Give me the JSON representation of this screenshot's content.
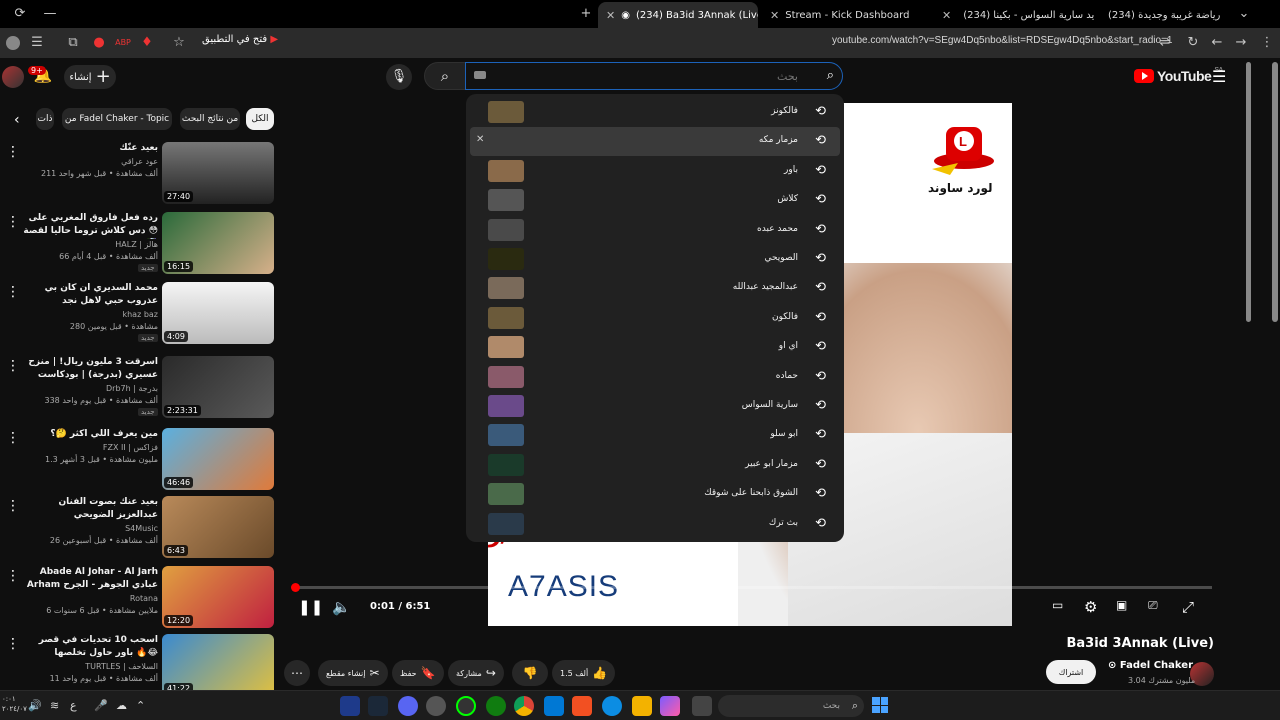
{
  "browser": {
    "tabs": [
      {
        "label": "(234) جربنا رياضة غريبة وجديدة"
      },
      {
        "label": "(234) جديد سارية السواس - بكينا"
      },
      {
        "label": "Stream - Kick Dashboard"
      },
      {
        "label": "(234) Ba3id 3Annak (Live)"
      }
    ],
    "open_in_app_label": "فتح في التطبيق",
    "url": "youtube.com/watch?v=SEgw4Dq5nbo&list=RDSEgw4Dq5nbo&start_radio=1"
  },
  "youtube": {
    "logo_text": "YouTube",
    "region": "SA",
    "create_label": "إنشاء",
    "notification_count": "9+",
    "search": {
      "placeholder": "بحث",
      "value": ""
    }
  },
  "suggestions": [
    {
      "label": "فالكونز"
    },
    {
      "label": "مزمار مكه"
    },
    {
      "label": "باور"
    },
    {
      "label": "كلاش"
    },
    {
      "label": "محمد عبده"
    },
    {
      "label": "الصويحي"
    },
    {
      "label": "عبدالمجيد عبدالله"
    },
    {
      "label": "فالكون"
    },
    {
      "label": "اي او"
    },
    {
      "label": "حماده"
    },
    {
      "label": "سارية السواس"
    },
    {
      "label": "ابو سلو"
    },
    {
      "label": "مزمار ابو عبير"
    },
    {
      "label": "الشوق ذابحنا على شوقك"
    },
    {
      "label": "بث ترك"
    }
  ],
  "chips": [
    {
      "label": "الكل"
    },
    {
      "label": "من نتائج البحث"
    },
    {
      "label": "من Fadel Chaker - Topic"
    },
    {
      "label": "ذات"
    }
  ],
  "related": [
    {
      "title": "بعيد عنّك",
      "channel": "عود عراقي",
      "meta": "211 ألف مشاهدة • قبل شهر واحد",
      "duration": "27:40",
      "new": ""
    },
    {
      "title": "رده فعل فاروق المغربي على دس كلاش تروما حاليا لقصة 😳🤯",
      "channel": "HALZ | هالز",
      "meta": "66 ألف مشاهدة • قبل 4 أيام",
      "duration": "16:15",
      "new": "جديد"
    },
    {
      "title": "محمد السديري ان كان بي عذروب حبي لاهل نجد",
      "channel": "khaz baz",
      "meta": "280 مشاهدة • قبل يومين",
      "duration": "4:09",
      "new": "جديد"
    },
    {
      "title": "اسرقت 3 مليون ريال! | منزح عسيري (بدرجة) | بودكاست يسير خير",
      "channel": "Drb7h | بدرجة",
      "meta": "338 ألف مشاهدة • قبل يوم واحد",
      "duration": "2:23:31",
      "new": "جديد"
    },
    {
      "title": "مين يعرف اللي اكثر 🤔؟",
      "channel": "FZX II | فزاكس",
      "meta": "1.3 مليون مشاهدة • قبل 3 أشهر",
      "duration": "46:46",
      "new": ""
    },
    {
      "title": "بعيد عنك بصوت الفنان عبدالعزيز الضويحي",
      "channel": "S4Music",
      "meta": "26 ألف مشاهدة • قبل أسبوعين",
      "duration": "6:43",
      "new": ""
    },
    {
      "title": "Abade Al Johar - Al Jarh Arham عبادي الجوهر - الجرح ارحم",
      "channel": "Rotana",
      "meta": "6 ملايين مشاهدة • قبل 6 سنوات",
      "duration": "12:20",
      "new": ""
    },
    {
      "title": "اسحب 10 تحديات في قصر باور حاول تخلصها 🔥😂",
      "channel": "TURTLES | السلاحف",
      "meta": "11 ألف مشاهدة • قبل يوم واحد",
      "duration": "41:22",
      "new": ""
    }
  ],
  "player": {
    "time": "0:01 / 6:51",
    "logo_text": "لورد ساوند",
    "watermark": "A7ASIS",
    "progress": 0.002
  },
  "video": {
    "title": "Ba3id 3Annak (Live)",
    "channel": "Fadel Chaker",
    "subscribers": "3.04 مليون مشترك",
    "subscribe_label": "اشتراك",
    "likes": "1.5 ألف",
    "share_label": "مشاركة",
    "save_label": "حفظ",
    "clip_label": "إنشاء مقطع"
  },
  "taskbar": {
    "search_placeholder": "بحث",
    "clock": "٠:٠١\n٢٠٢٤/٠٧"
  }
}
